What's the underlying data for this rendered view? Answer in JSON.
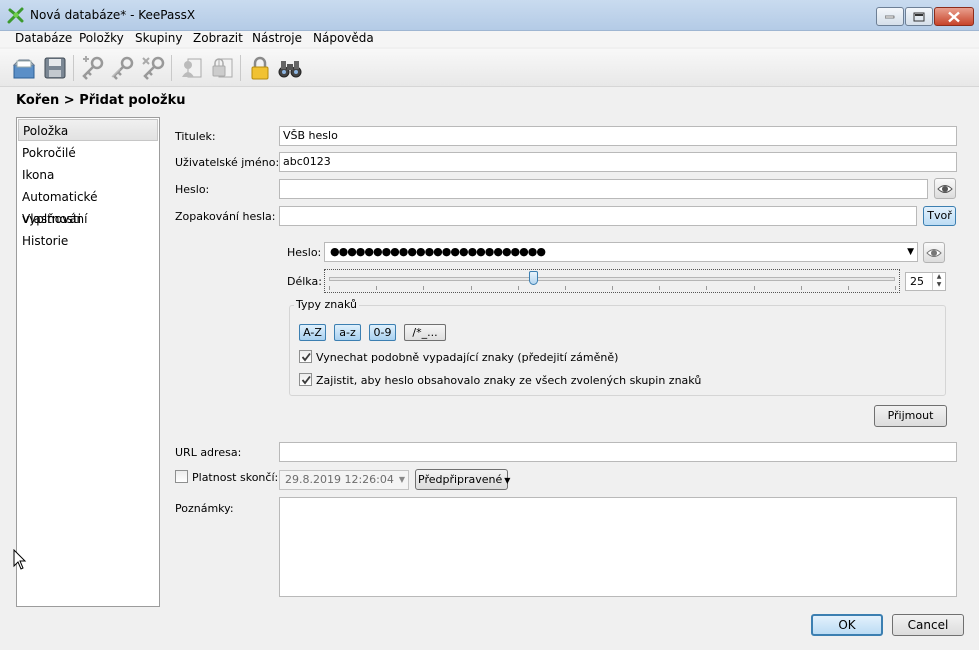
{
  "window": {
    "title": "Nová databáze* - KeePassX"
  },
  "menu": [
    "Databáze",
    "Položky",
    "Skupiny",
    "Zobrazit",
    "Nástroje",
    "Nápověda"
  ],
  "toolbar": {
    "icons": [
      "new-database-icon",
      "save-database-icon",
      "add-entry-icon",
      "edit-entry-icon",
      "delete-entry-icon",
      "copy-username-icon",
      "copy-password-icon",
      "lock-icon",
      "search-icon"
    ]
  },
  "breadcrumb": "Kořen > Přidat položku",
  "sidebar": {
    "items": [
      "Položka",
      "Pokročilé",
      "Ikona",
      "Automatické vyplňování",
      "Vlastnosti",
      "Historie"
    ],
    "selected": "Položka"
  },
  "form": {
    "title_label": "Titulek:",
    "title_value": "VŠB heslo",
    "username_label": "Uživatelské jméno:",
    "username_value": "abc0123",
    "password_label": "Heslo:",
    "password_value": "",
    "repeat_label": "Zopakování hesla:",
    "repeat_value": "",
    "generate_button": "Tvoř",
    "url_label": "URL adresa:",
    "url_value": "",
    "expires_label": "Platnost skončí:",
    "expires_checked": false,
    "expires_value": "29.8.2019 12:26:04",
    "presets_button": "Předpřipravené",
    "notes_label": "Poznámky:",
    "notes_value": ""
  },
  "generator": {
    "password_label": "Heslo:",
    "password_masked": "●●●●●●●●●●●●●●●●●●●●●●●●●",
    "length_label": "Délka:",
    "length_value": "25",
    "length_fraction": 0.36,
    "char_types_title": "Typy znaků",
    "char_buttons": [
      {
        "label": "A-Z",
        "active": true
      },
      {
        "label": "a-z",
        "active": true
      },
      {
        "label": "0-9",
        "active": true
      },
      {
        "label": "/*_...",
        "active": false
      }
    ],
    "exclude_similar_label": "Vynechat podobně vypadající znaky (předejití záměně)",
    "exclude_similar_checked": true,
    "every_group_label": "Zajistit, aby heslo obsahovalo znaky ze všech zvolených skupin znaků",
    "every_group_checked": true,
    "accept_button": "Přijmout"
  },
  "buttons": {
    "ok": "OK",
    "cancel": "Cancel"
  },
  "colors": {
    "accent_blue": "#3c7fb1",
    "titlebar": "#b9cfe8"
  }
}
